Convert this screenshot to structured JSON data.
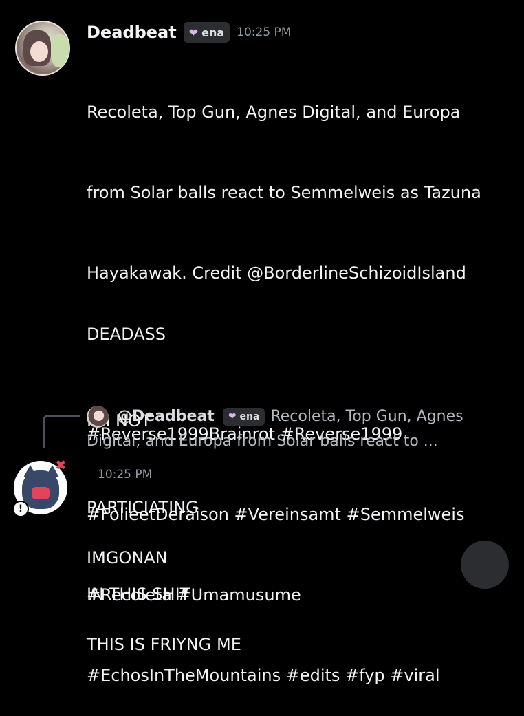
{
  "message1": {
    "username": "Deadbeat",
    "tag": {
      "icon": "heart-icon",
      "label": "ena"
    },
    "time": "10:25 PM",
    "text_lines": [
      "Recoleta, Top Gun, Agnes Digital, and Europa",
      "from Solar balls react to Semmelweis as Tazuna",
      "Hayakawak. Credit @BorderlineSchizoidIsland",
      "",
      "#Reverse1999Brainrot #Reverse1999",
      "#FolieetDeraison #Vereinsamt #Semmelweis",
      "#Recoleta #Umamusume",
      "#EchosInTheMountains #edits #fyp #viral"
    ],
    "caps_lines": [
      "DEADASS",
      "I'M NOT",
      "PARTICIATING",
      "IN THIS SHIT"
    ]
  },
  "reply": {
    "mention": "@Deadbeat",
    "tag": {
      "icon": "heart-icon",
      "label": "ena"
    },
    "preview_line1": "Recoleta, Top Gun, Agnes",
    "preview_line2": "Digital, and Europa from Solar balls react to ..."
  },
  "message2": {
    "time": "10:25 PM",
    "badge": "✖",
    "deco": "!",
    "lines": [
      "IMGONAN",
      "THIS IS FRIYNG ME"
    ]
  }
}
